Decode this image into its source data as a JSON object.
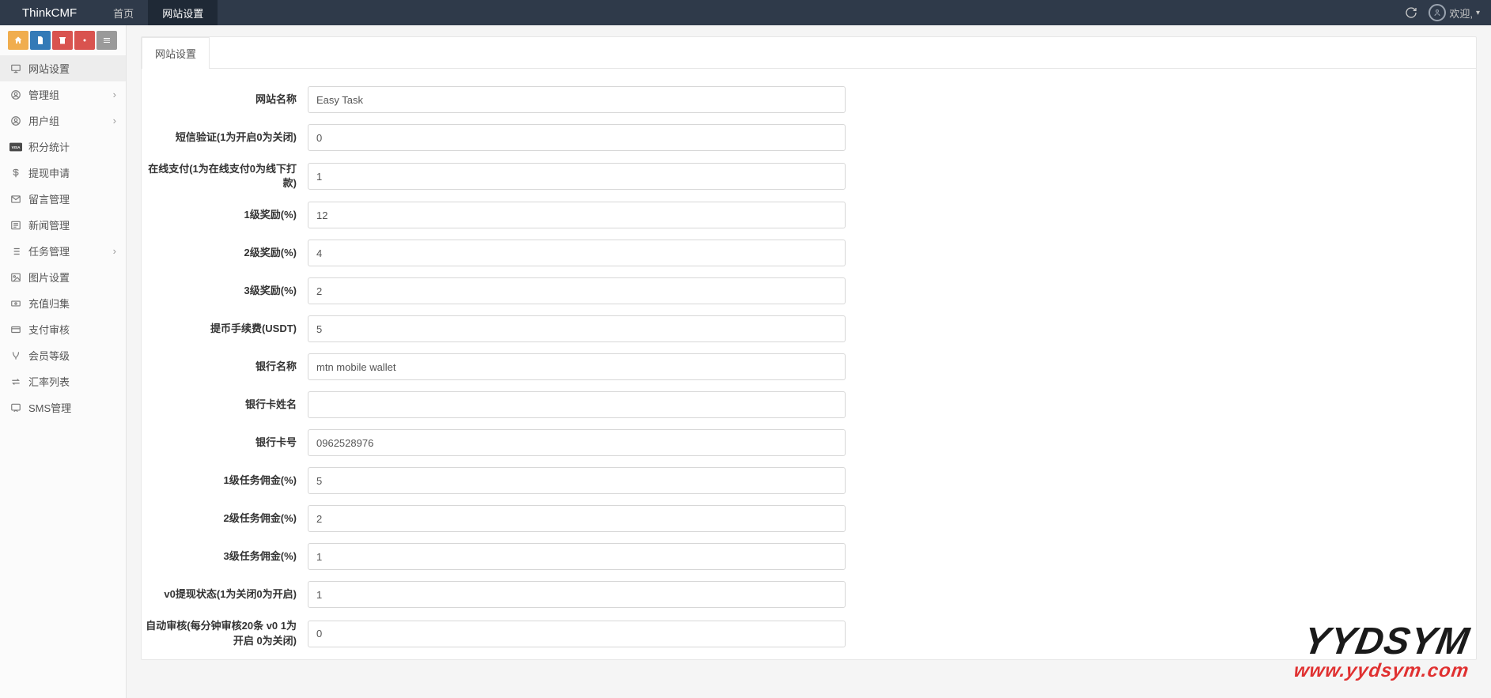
{
  "navbar": {
    "brand": "ThinkCMF",
    "tabs": [
      {
        "label": "首页"
      },
      {
        "label": "网站设置"
      }
    ],
    "welcome": "欢迎,"
  },
  "sidebar": {
    "items": [
      {
        "label": "网站设置",
        "icon": "monitor-icon",
        "expandable": false,
        "active": true
      },
      {
        "label": "管理组",
        "icon": "user-circle-icon",
        "expandable": true
      },
      {
        "label": "用户组",
        "icon": "user-circle-icon",
        "expandable": true
      },
      {
        "label": "积分统计",
        "icon": "visa-icon",
        "expandable": false
      },
      {
        "label": "提现申请",
        "icon": "dollar-icon",
        "expandable": false
      },
      {
        "label": "留言管理",
        "icon": "envelope-icon",
        "expandable": false
      },
      {
        "label": "新闻管理",
        "icon": "newspaper-icon",
        "expandable": false
      },
      {
        "label": "任务管理",
        "icon": "list-icon",
        "expandable": true
      },
      {
        "label": "图片设置",
        "icon": "image-icon",
        "expandable": false
      },
      {
        "label": "充值归集",
        "icon": "money-icon",
        "expandable": false
      },
      {
        "label": "支付审核",
        "icon": "card-icon",
        "expandable": false
      },
      {
        "label": "会员等级",
        "icon": "vine-icon",
        "expandable": false
      },
      {
        "label": "汇率列表",
        "icon": "exchange-icon",
        "expandable": false
      },
      {
        "label": "SMS管理",
        "icon": "sms-icon",
        "expandable": false
      }
    ]
  },
  "panel": {
    "tab": "网站设置",
    "fields": [
      {
        "label": "网站名称",
        "value": "Easy Task"
      },
      {
        "label": "短信验证(1为开启0为关闭)",
        "value": "0"
      },
      {
        "label": "在线支付(1为在线支付0为线下打款)",
        "value": "1"
      },
      {
        "label": "1级奖励(%)",
        "value": "12"
      },
      {
        "label": "2级奖励(%)",
        "value": "4"
      },
      {
        "label": "3级奖励(%)",
        "value": "2"
      },
      {
        "label": "提币手续费(USDT)",
        "value": "5"
      },
      {
        "label": "银行名称",
        "value": "mtn mobile wallet"
      },
      {
        "label": "银行卡姓名",
        "value": ""
      },
      {
        "label": "银行卡号",
        "value": "0962528976"
      },
      {
        "label": "1级任务佣金(%)",
        "value": "5"
      },
      {
        "label": "2级任务佣金(%)",
        "value": "2"
      },
      {
        "label": "3级任务佣金(%)",
        "value": "1"
      },
      {
        "label": "v0提现状态(1为关闭0为开启)",
        "value": "1"
      },
      {
        "label": "自动审核(每分钟审核20条 v0 1为开启 0为关闭)",
        "value": "0"
      }
    ]
  },
  "watermark": {
    "line1": "YYDSYM",
    "line2": "www.yydsym.com"
  }
}
